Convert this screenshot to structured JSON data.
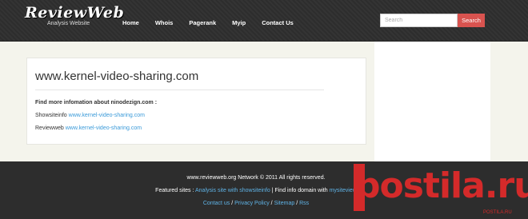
{
  "header": {
    "logo_title": "ReviewWeb",
    "logo_subtitle": "Analysis Website",
    "nav": [
      "Home",
      "Whois",
      "Pagerank",
      "Myip",
      "Contact Us"
    ],
    "search_placeholder": "Search",
    "search_button": "Search"
  },
  "main": {
    "domain_title": "www.kernel-video-sharing.com",
    "find_more": "Find more infomation about ninodezign.com :",
    "lines": [
      {
        "label": "Showsiteinfo",
        "link": "www.kernel-video-sharing.com"
      },
      {
        "label": "Reviewweb",
        "link": "www.kernel-video-sharing.com"
      }
    ]
  },
  "footer": {
    "copyright": "www.reviewweb.org Network © 2011 All rights reserved.",
    "featured_label": "Featured sites :",
    "featured_link1": "Analysis site with showsiteinfo",
    "featured_sep": "| Find info domain with",
    "featured_link2": "mysiteview",
    "links": [
      "Contact us",
      "Privacy Policy",
      "Sitemap",
      "Rss"
    ],
    "link_sep": "/"
  },
  "watermark": {
    "text": "postila.ru",
    "url": "POSTILA.RU"
  },
  "colors": {
    "header_bg": "#2d2d2d",
    "accent_red": "#d9534f",
    "link_blue": "#3a9ad9",
    "page_bg": "#f4f4ec"
  }
}
